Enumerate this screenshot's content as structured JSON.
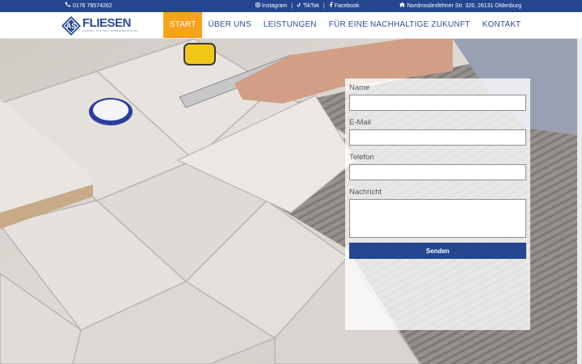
{
  "topbar": {
    "phone": "0176 78574262",
    "social": [
      "Instagram",
      "TikTok",
      "Facebook"
    ],
    "separator": "|",
    "address": "Nordmoslesfehner Str. 326, 26131 Oldenburg"
  },
  "logo": {
    "initials": "AS",
    "brand": "FLIESEN",
    "tagline": "FLIESEN · PLATTEN · MOSAIKVERLEGUNG"
  },
  "nav": {
    "items": [
      {
        "label": "START"
      },
      {
        "label": "ÜBER UNS"
      },
      {
        "label": "LEISTUNGEN"
      },
      {
        "label": "FÜR EINE NACHHALTIGE ZUKUNFT"
      },
      {
        "label": "KONTAKT"
      }
    ]
  },
  "form": {
    "name_label": "Name",
    "email_label": "E-Mail",
    "phone_label": "Telefon",
    "message_label": "Nachricht",
    "name_value": "",
    "email_value": "",
    "phone_value": "",
    "message_value": "",
    "submit_label": "Senden"
  },
  "colors": {
    "brand_blue": "#24468f",
    "accent_orange": "#f7a21b"
  }
}
